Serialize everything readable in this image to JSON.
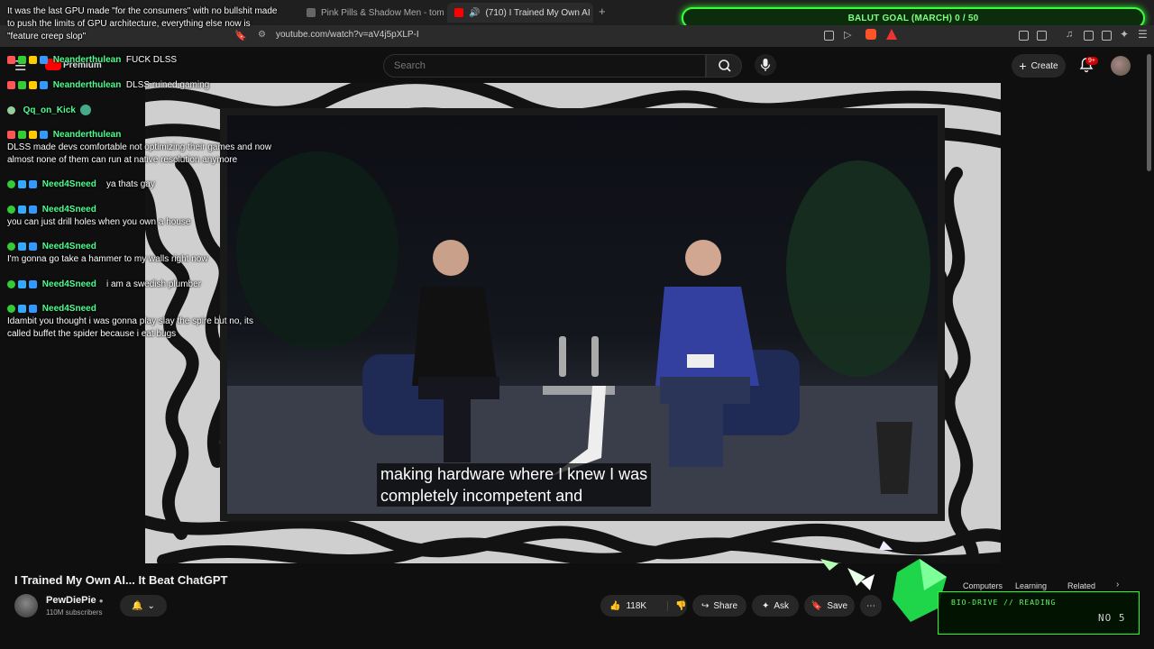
{
  "browser": {
    "tabs": [
      {
        "label": "Pink Pills & Shadow Men - tom m"
      },
      {
        "label": "(710) I Trained My Own AI"
      }
    ],
    "url": "youtube.com/watch?v=aV4j5pXLP-I"
  },
  "goal_bar": {
    "text": "BALUT GOAL (MARCH) 0 / 50"
  },
  "youtube": {
    "logo_text": "Premium",
    "search_placeholder": "Search",
    "create_label": "Create",
    "notif_badge": "9+"
  },
  "chat": {
    "pinned": "It was the last GPU made \"for the consumers\" with no bullshit made to push the limits of GPU architecture, everything else now is \"feature creep slop\"",
    "messages": [
      {
        "user": "Neanderthulean",
        "text": "FUCK DLSS"
      },
      {
        "user": "Neanderthulean",
        "text": "DLSS ruined gaming"
      },
      {
        "user": "Qq_on_Kick",
        "text": ""
      },
      {
        "user": "Neanderthulean",
        "text": "DLSS made devs comfortable not optimizing their games and now almost none of them can run at native resolution anymore"
      },
      {
        "user": "Need4Sneed",
        "text": "ya thats gay"
      },
      {
        "user": "Need4Sneed",
        "text": "you can just drill holes when you own a house"
      },
      {
        "user": "Need4Sneed",
        "text": "I'm gonna go take a hammer to my walls right now"
      },
      {
        "user": "Need4Sneed",
        "text": "i am a swedish plumber"
      },
      {
        "user": "Need4Sneed",
        "text": "Idambit you thought i was gonna play slay the spire but no, its called buffet the spider because i eat bugs"
      }
    ]
  },
  "video": {
    "caption_line1": "making hardware where I knew I was",
    "caption_line2": "completely incompetent and",
    "title": "I Trained My Own AI... It Beat ChatGPT",
    "channel": "PewDiePie",
    "subscribers": "110M subscribers",
    "likes": "118K",
    "share_label": "Share",
    "ask_label": "Ask",
    "save_label": "Save"
  },
  "chips": [
    "Computers",
    "Learning",
    "Related"
  ],
  "hud": {
    "title": "BIO-DRIVE // READING",
    "value": "NO 5"
  }
}
